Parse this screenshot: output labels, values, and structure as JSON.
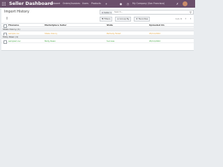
{
  "navbar": {
    "brand": "Seller Dashboard",
    "menu": [
      "Dashboard",
      "Orders/Invoices",
      "Users",
      "Products"
    ],
    "chat_count": "",
    "company": "My Company (San Francisco)",
    "colors": {
      "navbar": "#6b4f6b",
      "badge": "#00a09d"
    }
  },
  "page": {
    "title": "Import History",
    "search": {
      "facet_label": "Seller",
      "placeholder": "Search..."
    },
    "buttons": {
      "filters": "Filters",
      "group_by": "Group By",
      "favorites": "Favorites"
    },
    "pager": "1-2 / 2"
  },
  "table": {
    "columns": [
      "Filename",
      "Marketplace Seller",
      "State",
      "Uploaded On"
    ],
    "groups": [
      {
        "label": "Stake Clancy (1)",
        "rows": [
          {
            "filename": "sample.csv",
            "seller": "Stake Clancy",
            "state": "Partially Failed",
            "uploaded_on": "05/11/2022",
            "color": "#e0a23c"
          }
        ]
      },
      {
        "label": "Molly Rawn (1)",
        "rows": [
          {
            "filename": "sample2.csv",
            "seller": "Molly Rawn",
            "state": "Success",
            "uploaded_on": "05/11/2022",
            "color": "#3aa03a"
          }
        ]
      }
    ]
  }
}
